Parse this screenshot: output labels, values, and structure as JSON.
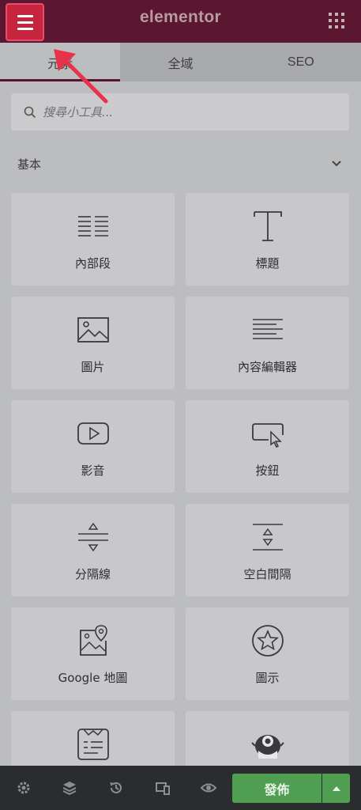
{
  "header": {
    "brand": "elementor"
  },
  "tabs": [
    {
      "label": "元素",
      "active": true
    },
    {
      "label": "全域",
      "active": false
    },
    {
      "label": "SEO",
      "active": false
    }
  ],
  "search": {
    "placeholder": "搜尋小工具..."
  },
  "section": {
    "title": "基本"
  },
  "widgets": [
    {
      "label": "內部段",
      "icon": "inner-section-icon"
    },
    {
      "label": "標題",
      "icon": "heading-icon"
    },
    {
      "label": "圖片",
      "icon": "image-icon"
    },
    {
      "label": "內容編輯器",
      "icon": "text-editor-icon"
    },
    {
      "label": "影音",
      "icon": "video-icon"
    },
    {
      "label": "按鈕",
      "icon": "button-icon"
    },
    {
      "label": "分隔線",
      "icon": "divider-icon"
    },
    {
      "label": "空白間隔",
      "icon": "spacer-icon"
    },
    {
      "label": "Google 地圖",
      "icon": "google-maps-icon"
    },
    {
      "label": "圖示",
      "icon": "star-icon"
    },
    {
      "label": "",
      "icon": "form-icon"
    },
    {
      "label": "",
      "icon": "mascot-icon"
    }
  ],
  "footer": {
    "publish_label": "發佈",
    "icons": [
      "settings-icon",
      "layers-icon",
      "history-icon",
      "responsive-icon",
      "preview-icon"
    ]
  },
  "colors": {
    "header_bg": "#5b1730",
    "highlight": "#c6253f",
    "publish_green": "#4f9e52",
    "arrow_red": "#e8324a"
  }
}
